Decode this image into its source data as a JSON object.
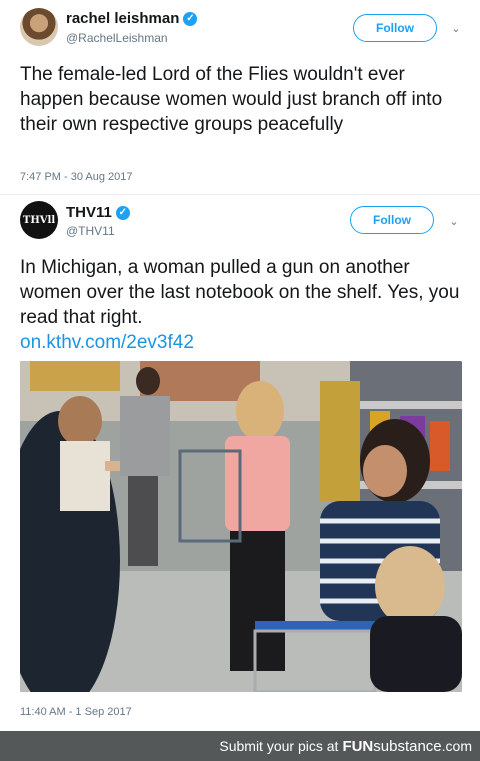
{
  "tweet1": {
    "display_name": "rachel leishman",
    "handle": "@RachelLeishman",
    "follow_label": "Follow",
    "text": "The female-led Lord of the Flies wouldn't ever happen because women would just branch off into their own respective groups peacefully",
    "timestamp": "7:47 PM - 30 Aug 2017"
  },
  "tweet2": {
    "display_name": "THV11",
    "handle": "@THV11",
    "avatar_text": "THVll",
    "follow_label": "Follow",
    "text": "In Michigan, a woman pulled a gun on another women over the last notebook on the shelf. Yes, you read that right.",
    "link": "on.kthv.com/2ev3f42",
    "timestamp": "11:40 AM - 1 Sep 2017"
  },
  "footer": {
    "prefix": "Submit your pics at",
    "brand_bold": "FUN",
    "brand_rest": "substance",
    "brand_suffix": ".com"
  },
  "colors": {
    "accent": "#1da1f2",
    "link": "#1b95e0",
    "muted": "#657786",
    "footer_bg": "#555859"
  },
  "icons": {
    "verified": "verified-badge-icon",
    "caret": "chevron-down-icon"
  }
}
